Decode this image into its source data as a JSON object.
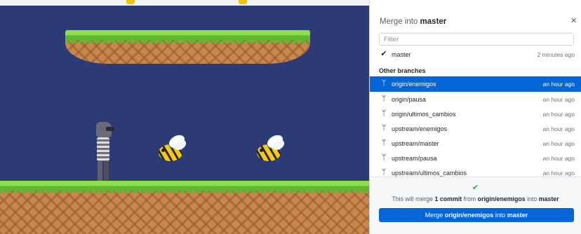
{
  "panel": {
    "title_prefix": "Merge into",
    "title_branch": "master",
    "close_glyph": "×",
    "filter_placeholder": "Filter",
    "current_branch": {
      "icon": "✔",
      "name": "master",
      "time": "2 minutes ago"
    },
    "section_label": "Other branches",
    "branch_icon": "ᛘ",
    "branches": [
      {
        "name": "origin/enemigos",
        "time": "an hour ago",
        "selected": true
      },
      {
        "name": "origin/pausa",
        "time": "an hour ago"
      },
      {
        "name": "origin/ultimos_cambios",
        "time": "an hour ago"
      },
      {
        "name": "upstream/enemigos",
        "time": "an hour ago"
      },
      {
        "name": "upstream/master",
        "time": "an hour ago"
      },
      {
        "name": "upstream/pausa",
        "time": "an hour ago"
      },
      {
        "name": "upstream/ultimos_cambios",
        "time": "an hour ago"
      }
    ],
    "footer": {
      "check_glyph": "✔",
      "summary_prefix": "This will merge",
      "summary_count": "1 commit",
      "summary_from": "from",
      "summary_source": "origin/enemigos",
      "summary_into": "into",
      "summary_target": "master",
      "button_prefix": "Merge",
      "button_source": "origin/enemigos",
      "button_into": "into",
      "button_target": "master"
    },
    "colors": {
      "accent": "#0366d6",
      "success": "#28a745"
    }
  }
}
